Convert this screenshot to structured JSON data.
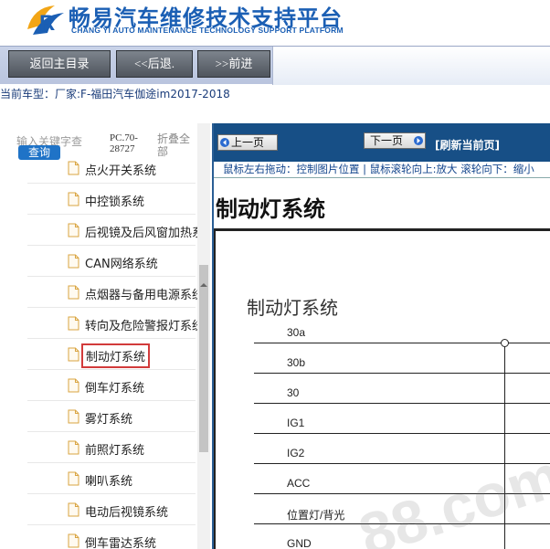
{
  "header": {
    "brand_cn": "畅易汽车维修技术支持平台",
    "brand_en": "CHANG YI AUTO MAINTENANCE TECHNOLOGY SUPPORT PLATFORM",
    "logo_letter": "R"
  },
  "nav": {
    "home": "返回主目录",
    "back": "<<后退.",
    "forward": ">>前进"
  },
  "car": {
    "label": "当前车型：",
    "value": "厂家:F-福田汽车伽途im2017-2018"
  },
  "left_panel": {
    "search_placeholder": "输入关键字查",
    "query_button": "查询",
    "pc_code": "PC.70-28727",
    "fold_all": "折叠全部",
    "items": [
      {
        "label": "点火开关系统"
      },
      {
        "label": "中控锁系统"
      },
      {
        "label": "后视镜及后风窗加热系统"
      },
      {
        "label": "CAN网络系统"
      },
      {
        "label": "点烟器与备用电源系统"
      },
      {
        "label": "转向及危险警报灯系统"
      },
      {
        "label": "制动灯系统",
        "selected": true
      },
      {
        "label": "倒车灯系统"
      },
      {
        "label": "雾灯系统"
      },
      {
        "label": "前照灯系统"
      },
      {
        "label": "喇叭系统"
      },
      {
        "label": "电动后视镜系统"
      },
      {
        "label": "倒车雷达系统"
      }
    ]
  },
  "toolbar": {
    "prev": "上一页",
    "next": "下一页",
    "refresh": "[刷新当前页]",
    "hint": "鼠标左右拖动：控制图片位置 | 鼠标滚轮向上:放大   滚轮向下：缩小"
  },
  "document": {
    "title": "制动灯系统",
    "diagram_title": "制动灯系统",
    "bus_lines": [
      "30a",
      "30b",
      "30",
      "IG1",
      "IG2",
      "ACC",
      "位置灯/背光",
      "GND"
    ]
  },
  "watermark": "88.com",
  "colors": {
    "brand_blue": "#1b5fb4",
    "toolbar_blue": "#174f86",
    "highlight_red": "#d23b3b",
    "query_blue": "#1f73c7"
  }
}
